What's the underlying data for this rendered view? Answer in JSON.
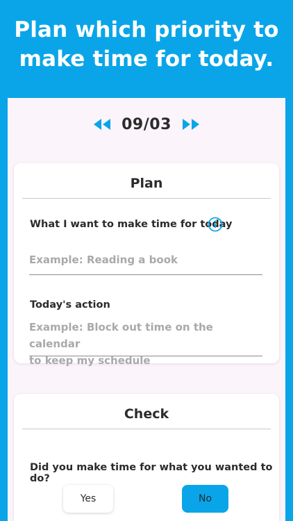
{
  "headline": {
    "line1": "Plan which priority to",
    "line2": "make time for today."
  },
  "date": {
    "value": "09/03"
  },
  "plan": {
    "title": "Plan",
    "want_label": "What I want to make time for today",
    "want_placeholder": "Example: Reading a book",
    "action_label": "Today's action",
    "action_placeholder_line1": "Example: Block out time on the calendar",
    "action_placeholder_line2": "to keep my schedule"
  },
  "check": {
    "title": "Check",
    "question": "Did you make time for what you wanted to do?",
    "yes_label": "Yes",
    "no_label": "No"
  },
  "colors": {
    "accent": "#0aa5e8",
    "background": "#fbf4fb"
  }
}
